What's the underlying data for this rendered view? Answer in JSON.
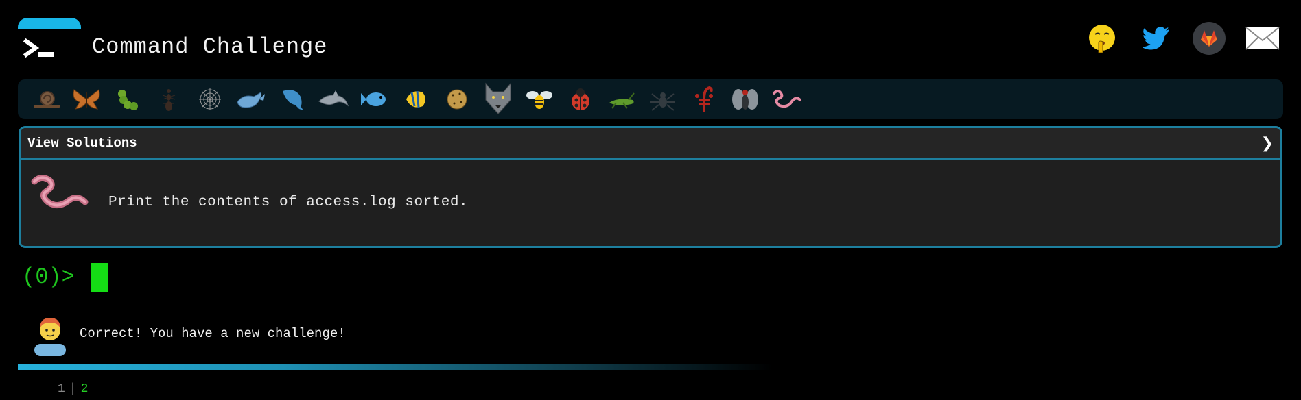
{
  "header": {
    "title": "Command Challenge",
    "social": [
      {
        "name": "shushing-face-icon"
      },
      {
        "name": "twitter-icon"
      },
      {
        "name": "gitlab-icon"
      },
      {
        "name": "email-icon"
      }
    ]
  },
  "achievements": [
    "snail-icon",
    "butterfly-icon",
    "caterpillar-icon",
    "ant-icon",
    "spider-web-icon",
    "whale-icon",
    "whale-2-icon",
    "dolphin-icon",
    "fish-icon",
    "tropical-fish-icon",
    "blowfish-icon",
    "wolf-icon",
    "bee-icon",
    "ladybug-icon",
    "cricket-icon",
    "spider-icon",
    "scorpion-icon",
    "fly-icon",
    "worm-icon"
  ],
  "panel": {
    "view_solutions": "View Solutions",
    "chevron": "❯",
    "task": "Print the contents of access.log sorted."
  },
  "prompt": {
    "text": "(0)>"
  },
  "feedback": {
    "message": "Correct! You have a new challenge!"
  },
  "pager": {
    "pages": [
      "1",
      "2"
    ],
    "current": "2",
    "separator": "|"
  },
  "colors": {
    "accent": "#19b7e8",
    "border": "#1d7f9e",
    "prompt": "#1ec61e",
    "cursor": "#15dd15"
  }
}
